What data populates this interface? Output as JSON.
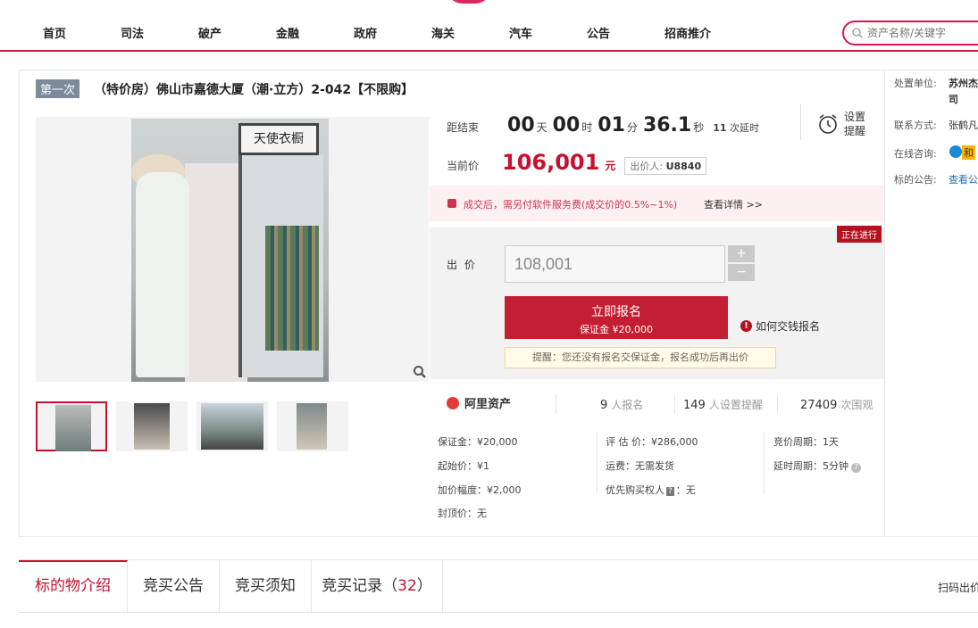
{
  "nav": {
    "items": [
      "首页",
      "司法",
      "破产",
      "金融",
      "政府",
      "海关",
      "汽车",
      "公告",
      "招商推介"
    ],
    "search_placeholder": "资产名称/关键字"
  },
  "auction": {
    "round_tag": "第一次",
    "title": "（特价房）佛山市嘉德大厦（潮·立方）2-042【不限购】",
    "photo_sign": "天使衣橱"
  },
  "countdown": {
    "label": "距结束",
    "days": "00",
    "days_unit": "天",
    "hours": "00",
    "hours_unit": "时",
    "minutes": "01",
    "minutes_unit": "分",
    "seconds": "36.1",
    "seconds_unit": "秒",
    "extensions": "11",
    "extensions_label": "次延时"
  },
  "reminder": {
    "line1": "设置",
    "line2": "提醒"
  },
  "price": {
    "label": "当前价",
    "amount": "106,001",
    "unit": "元",
    "bidder_label": "出价人:",
    "bidder_id": "U8840"
  },
  "notice": {
    "text": "成交后，需另付软件服务费(成交价的0.5%~1%)",
    "link": "查看详情 >>"
  },
  "bid": {
    "status": "正在进行",
    "label": "出 价",
    "value": "108,001",
    "plus": "+",
    "minus": "−",
    "signup_label": "立即报名",
    "deposit_label": "保证金 ¥20,000",
    "howto_label": "如何交钱报名",
    "tip": "提醒：您还没有报名交保证金，报名成功后再出价"
  },
  "stats": {
    "platform": "阿里资产",
    "signups": "9",
    "signups_label": "人报名",
    "reminders": "149",
    "reminders_label": "人设置提醒",
    "views": "27409",
    "views_label": "次围观"
  },
  "details": {
    "deposit": "保证金：¥20,000",
    "start_price": "起始价：¥1",
    "increment": "加价幅度：¥2,000",
    "cap_price": "封顶价：无",
    "appraisal": "评 估 价：¥286,000",
    "shipping": "运费：无需发货",
    "priority": "优先购买权人",
    "priority_badge": "?",
    "priority_value": "：无",
    "cycle": "竞价周期：1天",
    "delay": "延时周期：5分钟"
  },
  "side": {
    "unit_label": "处置单位:",
    "unit_value": "苏州杰",
    "unit_value2": "司",
    "contact_label": "联系方式:",
    "contact_value": "张鹤凡",
    "consult_label": "在线咨询:",
    "consult_badge": "和",
    "notice_label": "标的公告:",
    "notice_value": "查看公"
  },
  "tabs": {
    "t1": "标的物介绍",
    "t2": "竞买公告",
    "t3": "竞买须知",
    "t4": "竞买记录",
    "t4_count": "32",
    "scan": "扫码出价"
  },
  "colors": {
    "accent": "#c8102e",
    "nav_border": "#d51a4b"
  }
}
